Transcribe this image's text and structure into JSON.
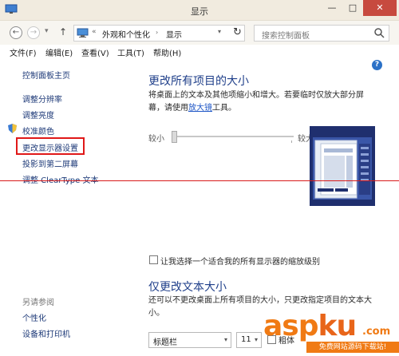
{
  "window": {
    "title": "显示",
    "minimize_glyph": "—",
    "maximize_glyph": "□",
    "close_glyph": "✕"
  },
  "address_bar": {
    "separator": "«",
    "crumbs": [
      "外观和个性化",
      "显示"
    ],
    "search_placeholder": "搜索控制面板",
    "icons": [
      "back-arrow-icon",
      "forward-arrow-icon",
      "up-arrow-icon",
      "monitor-icon",
      "refresh-icon",
      "search-icon"
    ]
  },
  "menu": [
    "文件(F)",
    "编辑(E)",
    "查看(V)",
    "工具(T)",
    "帮助(H)"
  ],
  "sidebar": {
    "links": [
      "控制面板主页",
      "调整分辨率",
      "调整亮度",
      "校准颜色",
      "更改显示器设置",
      "投影到第二屏幕",
      "调整 ClearType 文本"
    ],
    "highlighted_index": 4,
    "see_also_heading": "另请参阅",
    "see_also_links": [
      "个性化",
      "设备和打印机"
    ]
  },
  "main": {
    "section1": {
      "title": "更改所有项目的大小",
      "desc_before": "将桌面上的文本及其他项缩小和增大。若要临时仅放大部分屏幕，请使用",
      "desc_link": "放大镜",
      "desc_after": "工具。"
    },
    "slider": {
      "left_label": "较小",
      "right_label": "较大",
      "level": 0
    },
    "checkbox_label": "让我选择一个适合我的所有显示器的缩放级别",
    "checkbox_checked": false,
    "section2": {
      "title": "仅更改文本大小",
      "desc": "还可以不更改桌面上所有项目的大小，只更改指定项目的文本大小。"
    },
    "element_select": "标题栏",
    "size_select": "11",
    "bold_label": "粗体",
    "bold_checked": false
  },
  "watermark": {
    "main": "asp",
    "main2": "ku",
    "suffix": ".com",
    "sub": "免费网站源码下载站!"
  },
  "colors": {
    "accent": "#1f3f8a",
    "link": "#1e3a78",
    "highlight": "#e01818",
    "watermark": "#f07a14"
  }
}
